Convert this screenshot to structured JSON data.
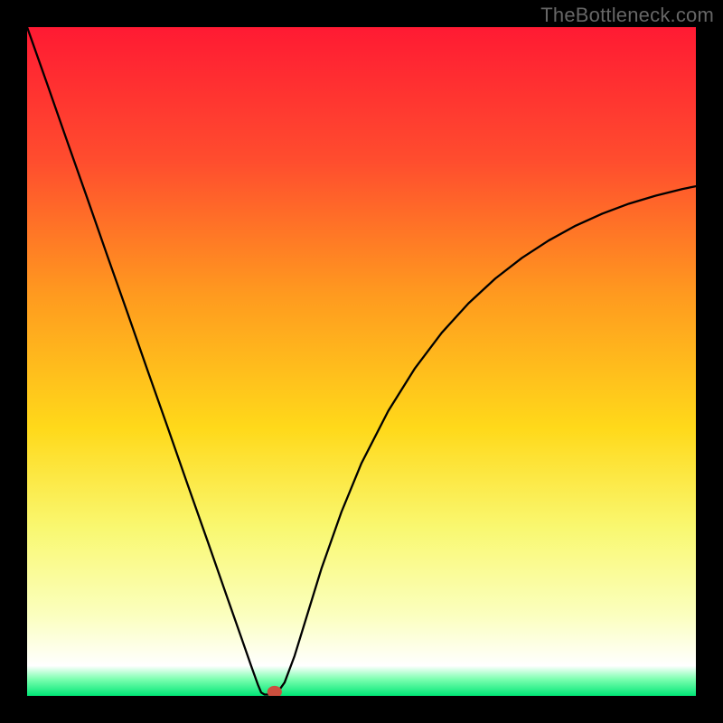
{
  "watermark": "TheBottleneck.com",
  "chart_data": {
    "type": "line",
    "title": "",
    "xlabel": "",
    "ylabel": "",
    "xlim": [
      0,
      100
    ],
    "ylim": [
      0,
      100
    ],
    "background_gradient": {
      "stops": [
        {
          "offset": 0.0,
          "color": "#ff1a33"
        },
        {
          "offset": 0.2,
          "color": "#ff4d2e"
        },
        {
          "offset": 0.4,
          "color": "#ff9a1f"
        },
        {
          "offset": 0.6,
          "color": "#ffd91a"
        },
        {
          "offset": 0.75,
          "color": "#f9f871"
        },
        {
          "offset": 0.88,
          "color": "#fbffbf"
        },
        {
          "offset": 0.955,
          "color": "#ffffff"
        },
        {
          "offset": 0.975,
          "color": "#7cffb0"
        },
        {
          "offset": 1.0,
          "color": "#00e676"
        }
      ]
    },
    "series": [
      {
        "name": "bottleneck-curve",
        "color": "#000000",
        "width": 2.3,
        "points": [
          {
            "x": 0.0,
            "y": 100.0
          },
          {
            "x": 3.0,
            "y": 91.5
          },
          {
            "x": 6.0,
            "y": 82.9
          },
          {
            "x": 9.0,
            "y": 74.4
          },
          {
            "x": 12.0,
            "y": 65.8
          },
          {
            "x": 15.0,
            "y": 57.3
          },
          {
            "x": 18.0,
            "y": 48.7
          },
          {
            "x": 21.0,
            "y": 40.2
          },
          {
            "x": 24.0,
            "y": 31.6
          },
          {
            "x": 27.0,
            "y": 23.1
          },
          {
            "x": 30.0,
            "y": 14.5
          },
          {
            "x": 32.0,
            "y": 8.8
          },
          {
            "x": 33.5,
            "y": 4.5
          },
          {
            "x": 34.5,
            "y": 1.7
          },
          {
            "x": 35.0,
            "y": 0.5
          },
          {
            "x": 35.5,
            "y": 0.2
          },
          {
            "x": 36.5,
            "y": 0.2
          },
          {
            "x": 37.5,
            "y": 0.6
          },
          {
            "x": 38.5,
            "y": 2.0
          },
          {
            "x": 40.0,
            "y": 6.0
          },
          {
            "x": 42.0,
            "y": 12.5
          },
          {
            "x": 44.0,
            "y": 19.0
          },
          {
            "x": 47.0,
            "y": 27.5
          },
          {
            "x": 50.0,
            "y": 34.8
          },
          {
            "x": 54.0,
            "y": 42.6
          },
          {
            "x": 58.0,
            "y": 49.0
          },
          {
            "x": 62.0,
            "y": 54.3
          },
          {
            "x": 66.0,
            "y": 58.7
          },
          {
            "x": 70.0,
            "y": 62.4
          },
          {
            "x": 74.0,
            "y": 65.5
          },
          {
            "x": 78.0,
            "y": 68.1
          },
          {
            "x": 82.0,
            "y": 70.3
          },
          {
            "x": 86.0,
            "y": 72.1
          },
          {
            "x": 90.0,
            "y": 73.6
          },
          {
            "x": 94.0,
            "y": 74.8
          },
          {
            "x": 98.0,
            "y": 75.8
          },
          {
            "x": 100.0,
            "y": 76.2
          }
        ]
      }
    ],
    "marker": {
      "x": 37.0,
      "y": 0.6,
      "rx": 1.1,
      "ry": 0.9,
      "color": "#cc4f3e"
    }
  }
}
